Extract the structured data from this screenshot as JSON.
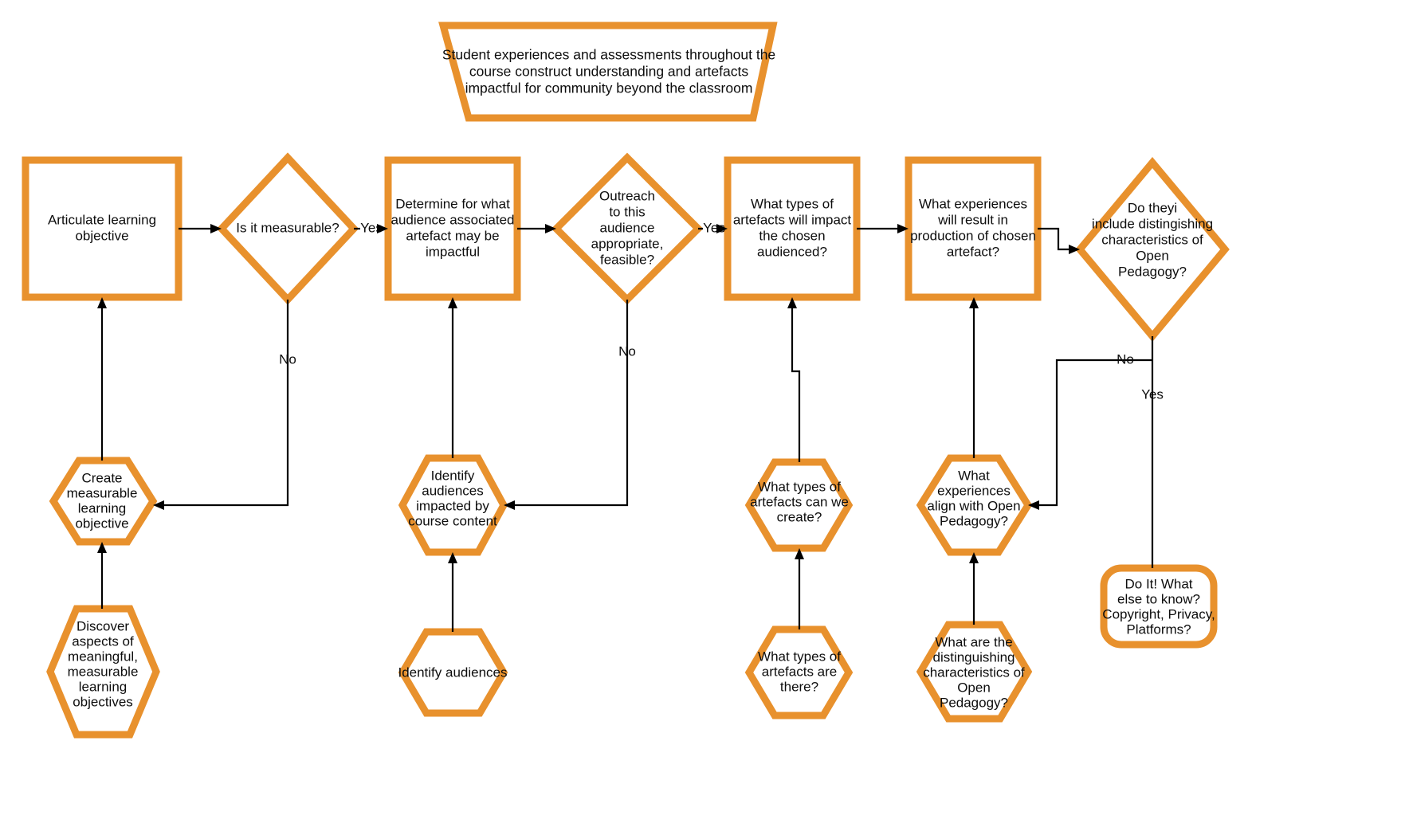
{
  "diagram": {
    "title_banner": {
      "id": "banner",
      "shape": "trapezoid",
      "lines": [
        "Student experiences and assessments throughout the",
        "course construct understanding and artefacts",
        "impactful for community beyond the classroom"
      ]
    },
    "colors": {
      "node_stroke": "#e8912d",
      "node_fill": "#ffffff",
      "connector": "#000000",
      "text": "#0d0d0d",
      "background": "#ffffff"
    },
    "nodes": [
      {
        "id": "articulate-learning-objective",
        "shape": "rectangle",
        "lines": [
          "Articulate learning",
          "objective"
        ]
      },
      {
        "id": "is-it-measurable",
        "shape": "diamond",
        "lines": [
          "Is it measurable?"
        ]
      },
      {
        "id": "determine-audience",
        "shape": "rectangle",
        "lines": [
          "Determine for what",
          "audience associated",
          "artefact may be",
          "impactful"
        ]
      },
      {
        "id": "outreach-feasible",
        "shape": "diamond",
        "lines": [
          "Outreach",
          "to this",
          "audience",
          "appropriate,",
          "feasible?"
        ]
      },
      {
        "id": "artefact-types-impact",
        "shape": "rectangle",
        "lines": [
          "What types of",
          "artefacts will impact",
          "the chosen",
          "audienced?"
        ]
      },
      {
        "id": "experiences-production",
        "shape": "rectangle",
        "lines": [
          "What experiences",
          "will result in",
          "production of chosen",
          "artefact?"
        ]
      },
      {
        "id": "distinguishing-open-pedagogy",
        "shape": "diamond",
        "lines": [
          "Do theyi",
          "include distingishing",
          "characteristics of",
          "Open",
          "Pedagogy?"
        ]
      },
      {
        "id": "create-measurable-objective",
        "shape": "hexagon",
        "lines": [
          "Create",
          "measurable",
          "learning",
          "objective"
        ]
      },
      {
        "id": "discover-aspects",
        "shape": "hexagon",
        "lines": [
          "Discover",
          "aspects of",
          "meaningful,",
          "measurable",
          "learning",
          "objectives"
        ]
      },
      {
        "id": "identify-audiences-impacted",
        "shape": "hexagon",
        "lines": [
          "Identify",
          "audiences",
          "impacted by",
          "course content"
        ]
      },
      {
        "id": "identify-audiences",
        "shape": "hexagon",
        "lines": [
          "Identify audiences"
        ]
      },
      {
        "id": "artefacts-can-we-create",
        "shape": "hexagon",
        "lines": [
          "What types of",
          "artefacts can we",
          "create?"
        ]
      },
      {
        "id": "artefacts-are-there",
        "shape": "hexagon",
        "lines": [
          "What types of",
          "artefacts are",
          "there?"
        ]
      },
      {
        "id": "experiences-align-open-pedagogy",
        "shape": "hexagon",
        "lines": [
          "What",
          "experiences",
          "align with Open",
          "Pedagogy?"
        ]
      },
      {
        "id": "distinguishing-characteristics",
        "shape": "hexagon",
        "lines": [
          "What are the",
          "distinguishing",
          "characteristics of",
          "Open",
          "Pedagogy?"
        ]
      },
      {
        "id": "do-it-what-else",
        "shape": "rounded-rectangle",
        "lines": [
          "Do It! What",
          "else to know?",
          "Copyright, Privacy,",
          "Platforms?"
        ]
      }
    ],
    "edge_labels": {
      "measurable_no": "No",
      "measurable_yes": "Yes",
      "outreach_no": "No",
      "outreach_yes": "Yes",
      "artefact_yes": "Yes",
      "pedagogy_no": "No",
      "pedagogy_yes": "Yes"
    }
  }
}
